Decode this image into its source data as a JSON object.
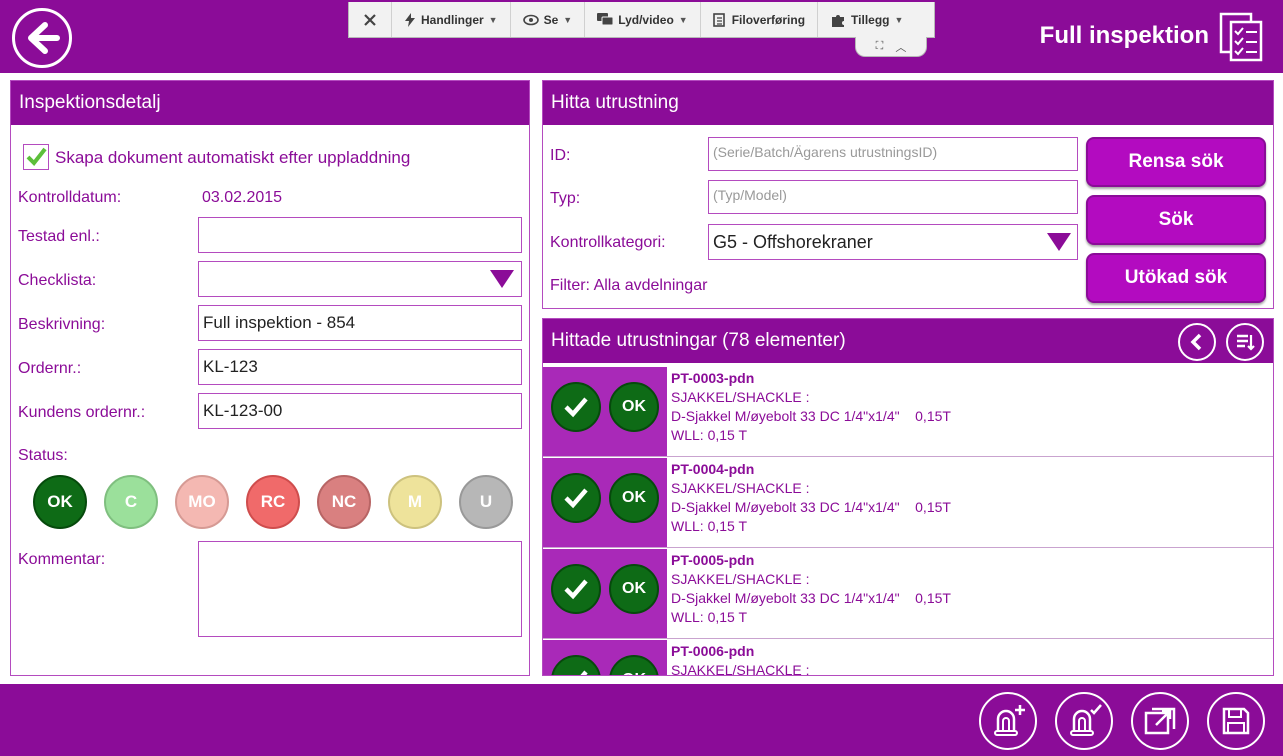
{
  "header": {
    "title": "Full inspektion",
    "back_icon": "arrow-left-icon",
    "doc_icon": "checklist-document-icon"
  },
  "toolbar": {
    "close_icon": "close-icon",
    "items": [
      {
        "label": "Handlinger",
        "icon": "lightning-icon"
      },
      {
        "label": "Se",
        "icon": "eye-icon"
      },
      {
        "label": "Lyd/video",
        "icon": "chat-icon"
      },
      {
        "label": "Filoverføring",
        "icon": "file-icon"
      },
      {
        "label": "Tillegg",
        "icon": "puzzle-icon"
      }
    ]
  },
  "left": {
    "title": "Inspektionsdetalj",
    "auto_doc_label": "Skapa dokument automatiskt efter uppladdning",
    "auto_doc_checked": true,
    "date_label": "Kontrolldatum:",
    "date_value": "03.02.2015",
    "tested_label": "Testad enl.:",
    "tested_value": "",
    "checklist_label": "Checklista:",
    "checklist_value": "",
    "desc_label": "Beskrivning:",
    "desc_value": "Full inspektion - 854",
    "order_label": "Ordernr.:",
    "order_value": "KL-123",
    "customer_order_label": "Kundens ordernr.:",
    "customer_order_value": "KL-123-00",
    "status_label": "Status:",
    "statuses": [
      {
        "label": "OK",
        "color": "#0e6b16",
        "border": "#064a0c"
      },
      {
        "label": "C",
        "color": "#9be09b",
        "border": "#7fbf7f"
      },
      {
        "label": "MO",
        "color": "#f4b8b2",
        "border": "#d69a94"
      },
      {
        "label": "RC",
        "color": "#f06a6a",
        "border": "#cf4d4d"
      },
      {
        "label": "NC",
        "color": "#d98080",
        "border": "#b86565"
      },
      {
        "label": "M",
        "color": "#eee39b",
        "border": "#cdc27e"
      },
      {
        "label": "U",
        "color": "#b7b7b7",
        "border": "#999999"
      }
    ],
    "comment_label": "Kommentar:"
  },
  "search": {
    "title": "Hitta utrustning",
    "id_label": "ID:",
    "id_placeholder": "(Serie/Batch/Ägarens utrustningsID)",
    "type_label": "Typ:",
    "type_placeholder": "(Typ/Model)",
    "category_label": "Kontrollkategori:",
    "category_value": "G5 - Offshorekraner",
    "filter_label": "Filter: Alla avdelningar",
    "clear_button": "Rensa sök",
    "search_button": "Sök",
    "advanced_button": "Utökad sök"
  },
  "results": {
    "title": "Hittade utrustningar (78 elementer)",
    "ok_label": "OK",
    "items": [
      {
        "id": "PT-0003-pdn",
        "line1": "SJAKKEL/SHACKLE :",
        "line2": "D-Sjakkel M/øyebolt 33 DC 1/4\"x1/4\"    0,15T",
        "line3": "WLL: 0,15 T"
      },
      {
        "id": "PT-0004-pdn",
        "line1": "SJAKKEL/SHACKLE :",
        "line2": "D-Sjakkel M/øyebolt 33 DC 1/4\"x1/4\"    0,15T",
        "line3": "WLL: 0,15 T"
      },
      {
        "id": "PT-0005-pdn",
        "line1": "SJAKKEL/SHACKLE :",
        "line2": "D-Sjakkel M/øyebolt 33 DC 1/4\"x1/4\"    0,15T",
        "line3": "WLL: 0,15 T"
      },
      {
        "id": "PT-0006-pdn",
        "line1": "SJAKKEL/SHACKLE :",
        "line2": "",
        "line3": ""
      }
    ]
  },
  "colors": {
    "brand": "#8b0c98",
    "accent": "#b30bc0",
    "ok_green": "#0e6b16"
  }
}
